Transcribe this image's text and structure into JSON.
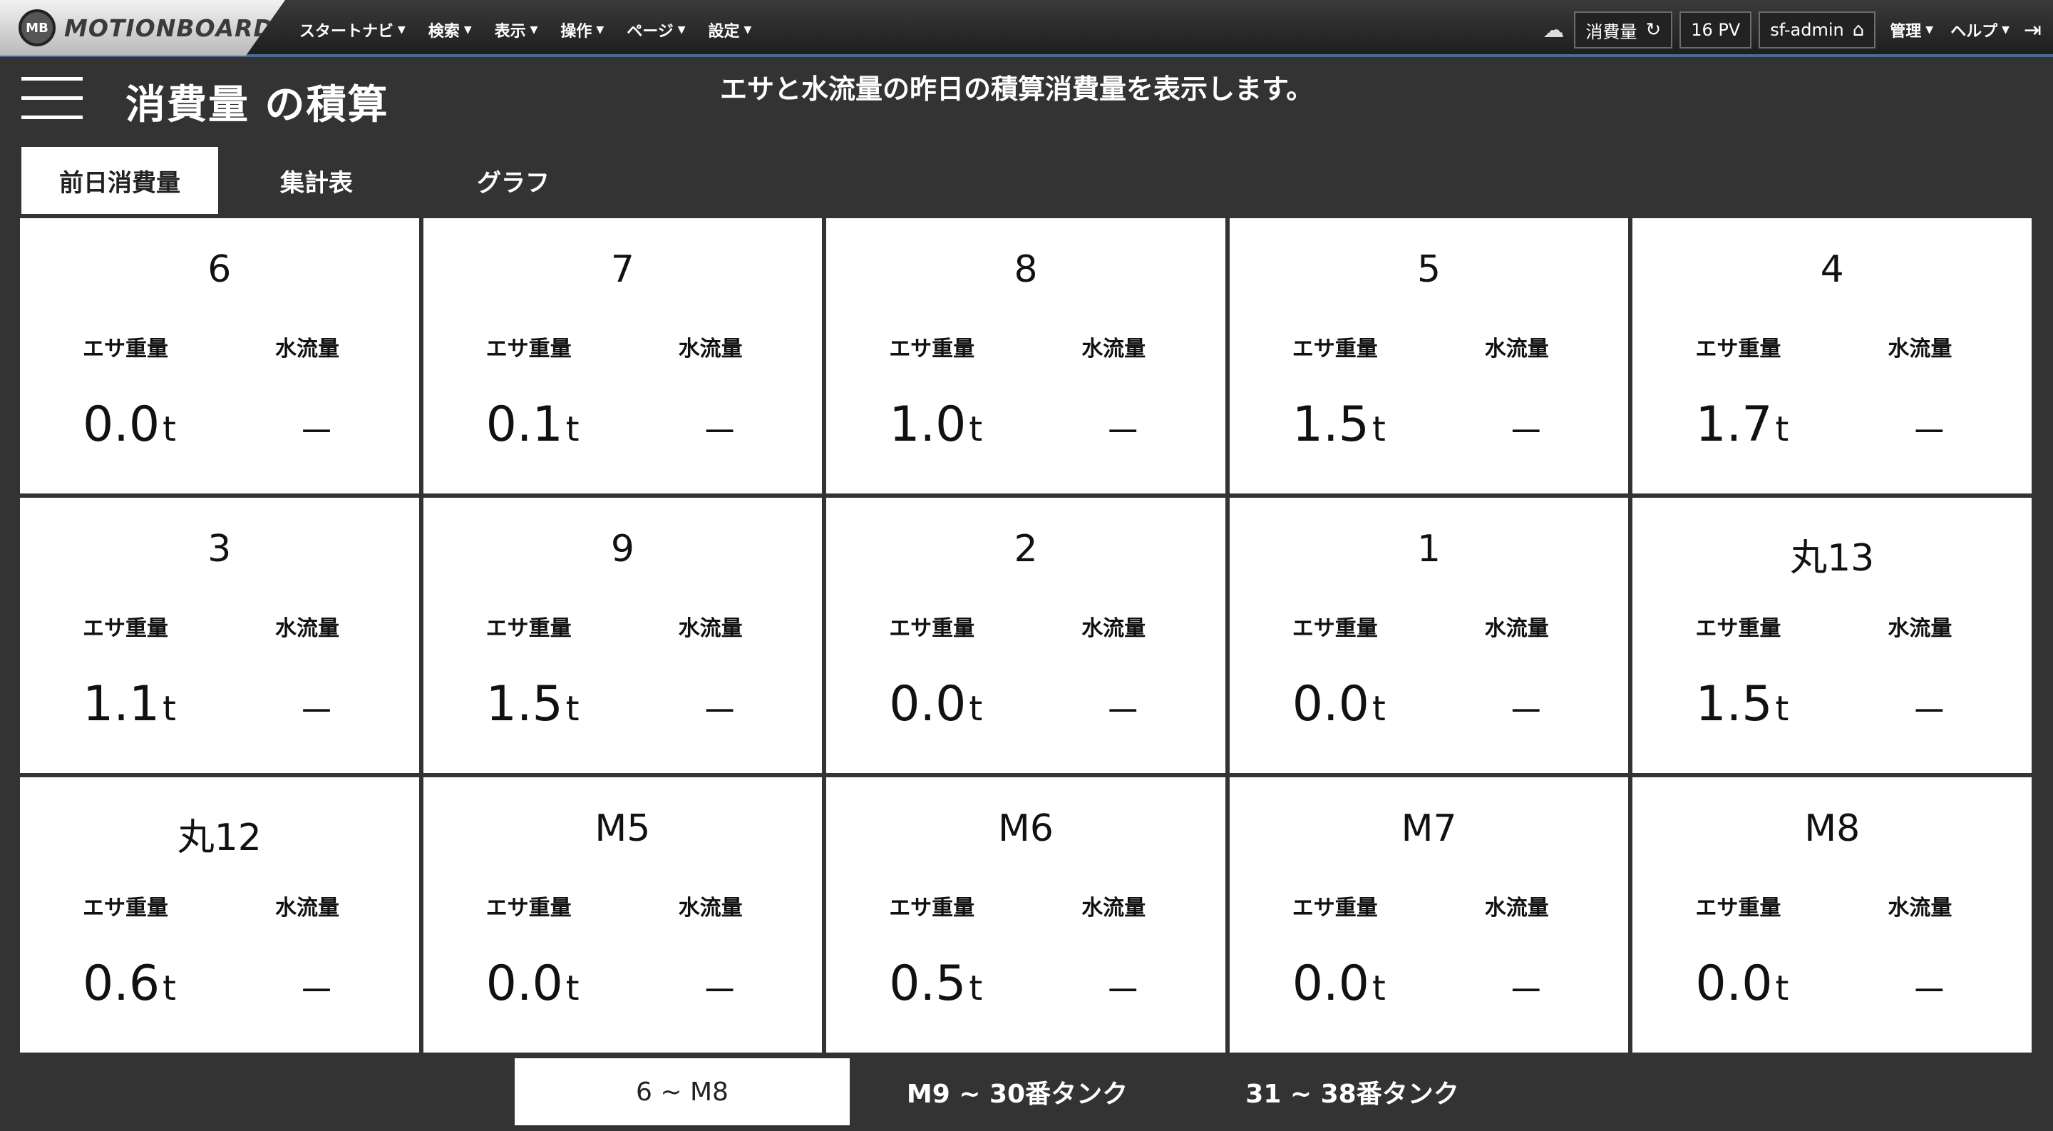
{
  "app": {
    "logo_mark": "MB",
    "logo_text": "MOTIONBOARD"
  },
  "menu": [
    {
      "label": "スタートナビ"
    },
    {
      "label": "検索"
    },
    {
      "label": "表示"
    },
    {
      "label": "操作"
    },
    {
      "label": "ページ"
    },
    {
      "label": "設定"
    }
  ],
  "toolbar": {
    "board_label": "消費量",
    "pv_label": "16 PV",
    "user_label": "sf-admin",
    "admin_menu": "管理",
    "help_menu": "ヘルプ"
  },
  "page": {
    "title": "消費量 の積算",
    "description": "エサと水流量の昨日の積算消費量を表示します。"
  },
  "tabs": [
    {
      "label": "前日消費量",
      "active": true
    },
    {
      "label": "集計表",
      "active": false
    },
    {
      "label": "グラフ",
      "active": false
    }
  ],
  "labels": {
    "feed": "エサ重量",
    "water": "水流量"
  },
  "tanks": [
    {
      "name": "6",
      "feed": "0.0",
      "unit": "t",
      "water": "－"
    },
    {
      "name": "7",
      "feed": "0.1",
      "unit": "t",
      "water": "－"
    },
    {
      "name": "8",
      "feed": "1.0",
      "unit": "t",
      "water": "－"
    },
    {
      "name": "5",
      "feed": "1.5",
      "unit": "t",
      "water": "－"
    },
    {
      "name": "4",
      "feed": "1.7",
      "unit": "t",
      "water": "－"
    },
    {
      "name": "3",
      "feed": "1.1",
      "unit": "t",
      "water": "－"
    },
    {
      "name": "9",
      "feed": "1.5",
      "unit": "t",
      "water": "－"
    },
    {
      "name": "2",
      "feed": "0.0",
      "unit": "t",
      "water": "－"
    },
    {
      "name": "1",
      "feed": "0.0",
      "unit": "t",
      "water": "－"
    },
    {
      "name": "丸13",
      "feed": "1.5",
      "unit": "t",
      "water": "－"
    },
    {
      "name": "丸12",
      "feed": "0.6",
      "unit": "t",
      "water": "－"
    },
    {
      "name": "M5",
      "feed": "0.0",
      "unit": "t",
      "water": "－"
    },
    {
      "name": "M6",
      "feed": "0.5",
      "unit": "t",
      "water": "－"
    },
    {
      "name": "M7",
      "feed": "0.0",
      "unit": "t",
      "water": "－"
    },
    {
      "name": "M8",
      "feed": "0.0",
      "unit": "t",
      "water": "－"
    }
  ],
  "pager": [
    {
      "label": "6 ~ M8",
      "active": true
    },
    {
      "label": "M9 ~ 30番タンク",
      "active": false
    },
    {
      "label": "31 ~ 38番タンク",
      "active": false
    }
  ]
}
